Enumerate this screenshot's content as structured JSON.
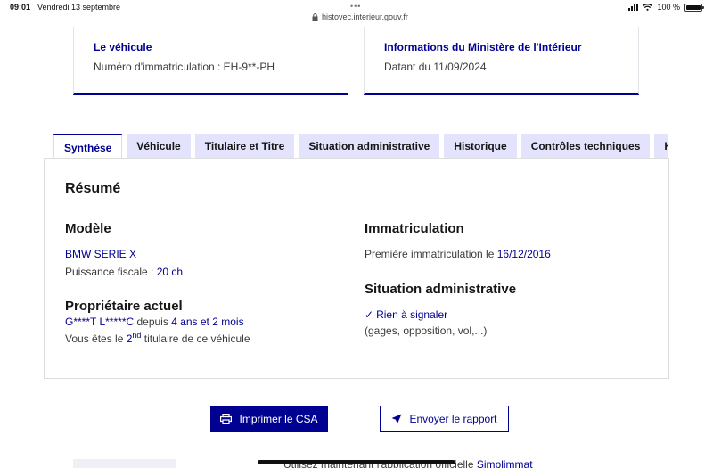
{
  "status_bar": {
    "time": "09:01",
    "date": "Vendredi 13 septembre",
    "dots": "•••",
    "url": "histovec.interieur.gouv.fr",
    "battery": "100 %"
  },
  "cards": {
    "vehicle": {
      "title": "Le véhicule",
      "text": "Numéro d'immatriculation : EH-9**-PH"
    },
    "ministry": {
      "title": "Informations du Ministère de l'Intérieur",
      "text": "Datant du 11/09/2024"
    }
  },
  "tabs": [
    {
      "label": "Synthèse",
      "active": true
    },
    {
      "label": "Véhicule",
      "active": false
    },
    {
      "label": "Titulaire et Titre",
      "active": false
    },
    {
      "label": "Situation administrative",
      "active": false
    },
    {
      "label": "Historique",
      "active": false
    },
    {
      "label": "Contrôles techniques",
      "active": false
    },
    {
      "label": "Kilo",
      "active": false
    }
  ],
  "summary": {
    "title": "Résumé",
    "model": {
      "heading": "Modèle",
      "name": "BMW SERIE X",
      "fiscal_label": "Puissance fiscale : ",
      "fiscal_value": "20 ch"
    },
    "owner": {
      "heading": "Propriétaire actuel",
      "name": "G****T L*****C",
      "since_label": " depuis ",
      "since_value": "4 ans et 2 mois",
      "rank_prefix": "Vous êtes le ",
      "rank_number": "2",
      "rank_sup": "nd",
      "rank_suffix": " titulaire de ce véhicule"
    },
    "registration": {
      "heading": "Immatriculation",
      "label": "Première immatriculation le ",
      "date": "16/12/2016"
    },
    "admin": {
      "heading": "Situation administrative",
      "status": "Rien à signaler",
      "details": "(gages, opposition, vol,...)"
    }
  },
  "buttons": {
    "print": "Imprimer le CSA",
    "send": "Envoyer le rapport"
  },
  "footer_partial": {
    "text_prefix": "Utilisez maintenant l'application officielle ",
    "link": "Simplimmat"
  },
  "colors": {
    "accent": "#000091",
    "tab_bg": "#e3e3fd",
    "text": "#3a3a3a"
  }
}
